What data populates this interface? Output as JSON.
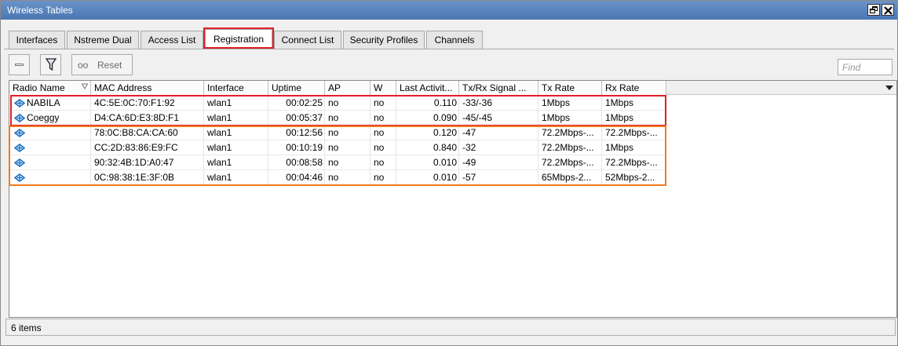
{
  "window": {
    "title": "Wireless Tables"
  },
  "tabs": [
    {
      "label": "Interfaces"
    },
    {
      "label": "Nstreme Dual"
    },
    {
      "label": "Access List"
    },
    {
      "label": "Registration"
    },
    {
      "label": "Connect List"
    },
    {
      "label": "Security Profiles"
    },
    {
      "label": "Channels"
    }
  ],
  "toolbar": {
    "reset_icon": "oo",
    "reset_label": "Reset"
  },
  "find": {
    "placeholder": "Find"
  },
  "table": {
    "columns": [
      {
        "label": "Radio Name"
      },
      {
        "label": "MAC Address"
      },
      {
        "label": "Interface"
      },
      {
        "label": "Uptime"
      },
      {
        "label": "AP"
      },
      {
        "label": "W"
      },
      {
        "label": "Last Activit..."
      },
      {
        "label": "Tx/Rx Signal ..."
      },
      {
        "label": "Tx Rate"
      },
      {
        "label": "Rx Rate"
      }
    ],
    "rows": [
      {
        "name": "NABILA",
        "mac": "4C:5E:0C:70:F1:92",
        "iface": "wlan1",
        "uptime": "00:02:25",
        "ap": "no",
        "w": "no",
        "last": "0.110",
        "signal": "-33/-36",
        "tx": "1Mbps",
        "rx": "1Mbps"
      },
      {
        "name": "Coeggy",
        "mac": "D4:CA:6D:E3:8D:F1",
        "iface": "wlan1",
        "uptime": "00:05:37",
        "ap": "no",
        "w": "no",
        "last": "0.090",
        "signal": "-45/-45",
        "tx": "1Mbps",
        "rx": "1Mbps"
      },
      {
        "name": "",
        "mac": "78:0C:B8:CA:CA:60",
        "iface": "wlan1",
        "uptime": "00:12:56",
        "ap": "no",
        "w": "no",
        "last": "0.120",
        "signal": "-47",
        "tx": "72.2Mbps-...",
        "rx": "72.2Mbps-..."
      },
      {
        "name": "",
        "mac": "CC:2D:83:86:E9:FC",
        "iface": "wlan1",
        "uptime": "00:10:19",
        "ap": "no",
        "w": "no",
        "last": "0.840",
        "signal": "-32",
        "tx": "72.2Mbps-...",
        "rx": "1Mbps"
      },
      {
        "name": "",
        "mac": "90:32:4B:1D:A0:47",
        "iface": "wlan1",
        "uptime": "00:08:58",
        "ap": "no",
        "w": "no",
        "last": "0.010",
        "signal": "-49",
        "tx": "72.2Mbps-...",
        "rx": "72.2Mbps-..."
      },
      {
        "name": "",
        "mac": "0C:98:38:1E:3F:0B",
        "iface": "wlan1",
        "uptime": "00:04:46",
        "ap": "no",
        "w": "no",
        "last": "0.010",
        "signal": "-57",
        "tx": "65Mbps-2...",
        "rx": "52Mbps-2..."
      }
    ]
  },
  "status": {
    "items_text": "6 items"
  },
  "colors": {
    "title_bar": "#5a84be",
    "highlight_red": "#e0202a",
    "highlight_orange": "#f07a20",
    "station_icon": "#1a6fc0"
  },
  "icons": {
    "station": "wireless-station-icon",
    "filter": "filter-icon",
    "restore": "restore-icon",
    "close": "close-icon"
  }
}
